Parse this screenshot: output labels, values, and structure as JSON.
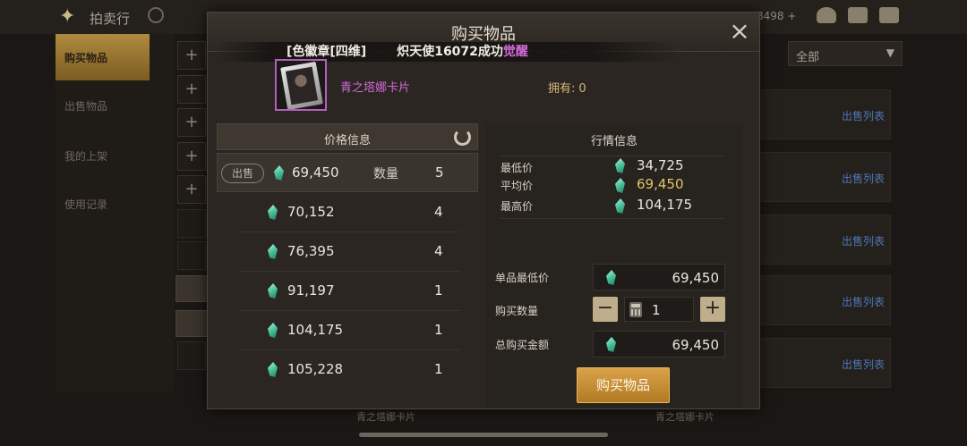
{
  "background": {
    "title": "拍卖行",
    "currency_partial": "8498 +",
    "sidebar": [
      "购买物品",
      "出售物品",
      "我的上架",
      "使用记录"
    ],
    "dropdown_label": "全部",
    "row_link": "出售列表",
    "bottom_left_text": "青之塔娜卡片",
    "bottom_right_text": "青之塔娜卡片"
  },
  "modal": {
    "title": "购买物品",
    "close_icon": "×",
    "broadcast": {
      "part1": "[色徽章[四维]",
      "part2": "炽天使16072成功",
      "highlight": "觉醒"
    },
    "item": {
      "name": "青之塔娜卡片",
      "owned_label": "拥有:",
      "owned_value": "0"
    },
    "price_panel": {
      "title": "价格信息",
      "sell_tag": "出售",
      "quantity_label": "数量",
      "rows": [
        {
          "price": "69,450",
          "qty": "5"
        },
        {
          "price": "70,152",
          "qty": "4"
        },
        {
          "price": "76,395",
          "qty": "4"
        },
        {
          "price": "91,197",
          "qty": "1"
        },
        {
          "price": "104,175",
          "qty": "1"
        },
        {
          "price": "105,228",
          "qty": "1"
        }
      ]
    },
    "market_panel": {
      "title": "行情信息",
      "min_label": "最低价",
      "min_value": "34,725",
      "avg_label": "平均价",
      "avg_value": "69,450",
      "max_label": "最高价",
      "max_value": "104,175"
    },
    "purchase": {
      "unit_min_label": "单品最低价",
      "unit_min_value": "69,450",
      "qty_label": "购买数量",
      "qty_value": "1",
      "minus": "−",
      "plus": "+",
      "total_label": "总购买金额",
      "total_value": "69,450",
      "buy_button": "购买物品"
    }
  },
  "colors": {
    "accent_gold": "#d9a24a",
    "item_purple": "#d36ad8",
    "avg_yellow": "#e6c565",
    "gem_green": "#4fc7a0"
  }
}
